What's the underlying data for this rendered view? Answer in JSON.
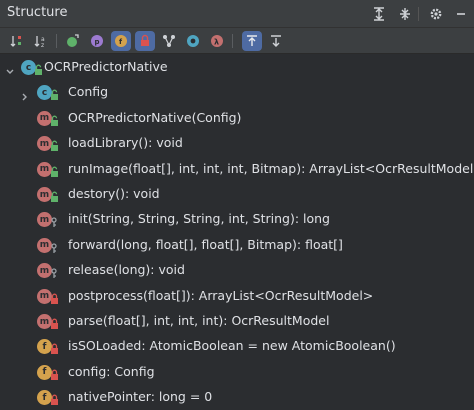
{
  "window": {
    "title": "Structure"
  },
  "title_actions": [
    {
      "name": "expand-all-icon"
    },
    {
      "name": "collapse-all-icon"
    },
    {
      "name": "gear-icon"
    },
    {
      "name": "minimize-icon"
    }
  ],
  "toolbar": [
    {
      "name": "sort-by-visibility-icon",
      "active": false
    },
    {
      "name": "sort-alphabetically-icon",
      "active": false
    },
    {
      "name": "show-inherited-icon",
      "active": false
    },
    {
      "name": "show-properties-icon",
      "active": false
    },
    {
      "name": "show-fields-icon",
      "active": true
    },
    {
      "name": "show-non-public-icon",
      "active": true
    },
    {
      "name": "show-lambdas-icon",
      "active": false
    },
    {
      "name": "show-anonymous-icon",
      "active": false
    },
    {
      "name": "show-lambda-icon",
      "active": false
    },
    {
      "name": "autoscroll-to-source-icon",
      "active": true
    },
    {
      "name": "autoscroll-from-source-icon",
      "active": false
    }
  ],
  "tree": [
    {
      "indent": 0,
      "arrow": "down",
      "icon": "c",
      "vis": "public",
      "text": "OCRPredictorNative"
    },
    {
      "indent": 1,
      "arrow": "right",
      "icon": "c",
      "vis": "public",
      "text": "Config"
    },
    {
      "indent": 1,
      "arrow": "",
      "icon": "m",
      "vis": "public",
      "text": "OCRPredictorNative(Config)"
    },
    {
      "indent": 1,
      "arrow": "",
      "icon": "m",
      "vis": "public",
      "text": "loadLibrary(): void"
    },
    {
      "indent": 1,
      "arrow": "",
      "icon": "m",
      "vis": "public",
      "text": "runImage(float[], int, int, int, Bitmap): ArrayList<OcrResultModel>"
    },
    {
      "indent": 1,
      "arrow": "",
      "icon": "m",
      "vis": "public",
      "text": "destory(): void"
    },
    {
      "indent": 1,
      "arrow": "",
      "icon": "m",
      "vis": "package",
      "text": "init(String, String, String, int, String): long"
    },
    {
      "indent": 1,
      "arrow": "",
      "icon": "m",
      "vis": "package",
      "text": "forward(long, float[], float[], Bitmap): float[]"
    },
    {
      "indent": 1,
      "arrow": "",
      "icon": "m",
      "vis": "package",
      "text": "release(long): void"
    },
    {
      "indent": 1,
      "arrow": "",
      "icon": "m",
      "vis": "private",
      "text": "postprocess(float[]): ArrayList<OcrResultModel>"
    },
    {
      "indent": 1,
      "arrow": "",
      "icon": "m",
      "vis": "private",
      "text": "parse(float[], int, int, int): OcrResultModel"
    },
    {
      "indent": 1,
      "arrow": "",
      "icon": "f",
      "vis": "private",
      "text": "isSOLoaded: AtomicBoolean = new AtomicBoolean()"
    },
    {
      "indent": 1,
      "arrow": "",
      "icon": "f",
      "vis": "private",
      "text": "config: Config"
    },
    {
      "indent": 1,
      "arrow": "",
      "icon": "f",
      "vis": "private",
      "text": "nativePointer: long = 0"
    }
  ],
  "colors": {
    "method": "#c3706f",
    "field": "#d4a24d",
    "class": "#4fa5c1",
    "public": "#5fb26a",
    "private": "#d9534f",
    "package": "#9aa0a6",
    "active_tool": "#4e6ba3"
  }
}
